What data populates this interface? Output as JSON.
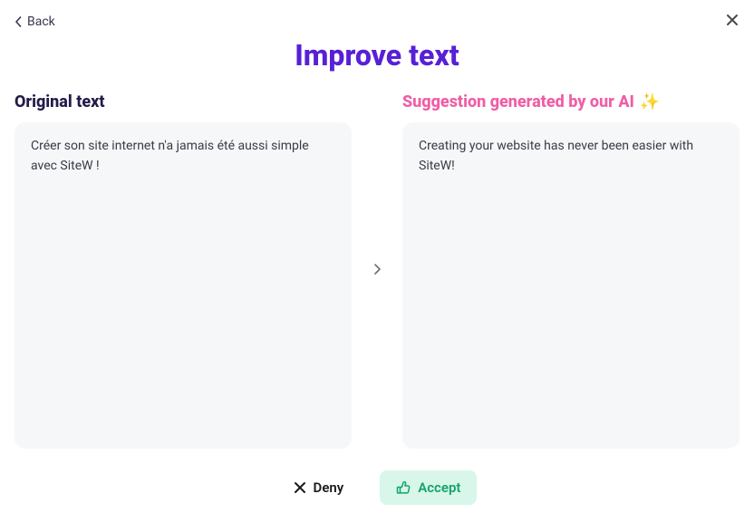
{
  "header": {
    "back_label": "Back",
    "title": "Improve text"
  },
  "columns": {
    "original": {
      "heading": "Original text",
      "body": "Créer son site internet n'a jamais été aussi simple avec SiteW !"
    },
    "suggestion": {
      "heading": "Suggestion generated by our AI",
      "sparkle": "✨",
      "body": "Creating your website has never been easier with SiteW!"
    }
  },
  "actions": {
    "deny_label": "Deny",
    "accept_label": "Accept"
  }
}
